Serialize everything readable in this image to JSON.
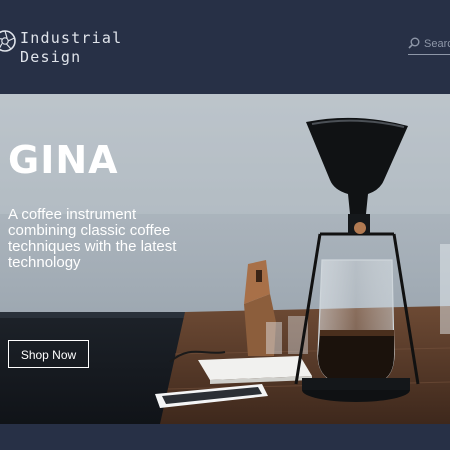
{
  "header": {
    "brand_line1": "Industrial",
    "brand_line2": "Design",
    "logo_icon": "aperture-logo-icon",
    "search": {
      "placeholder": "Search",
      "icon": "search-icon"
    }
  },
  "hero": {
    "title": "GINA",
    "description": "A coffee instrument combining classic coffee techniques with the latest technology",
    "cta_label": "Shop Now"
  },
  "colors": {
    "header_bg": "#273046",
    "text_light": "#ffffff",
    "muted": "#8e97a8",
    "table_wood": "#5a3a28"
  }
}
